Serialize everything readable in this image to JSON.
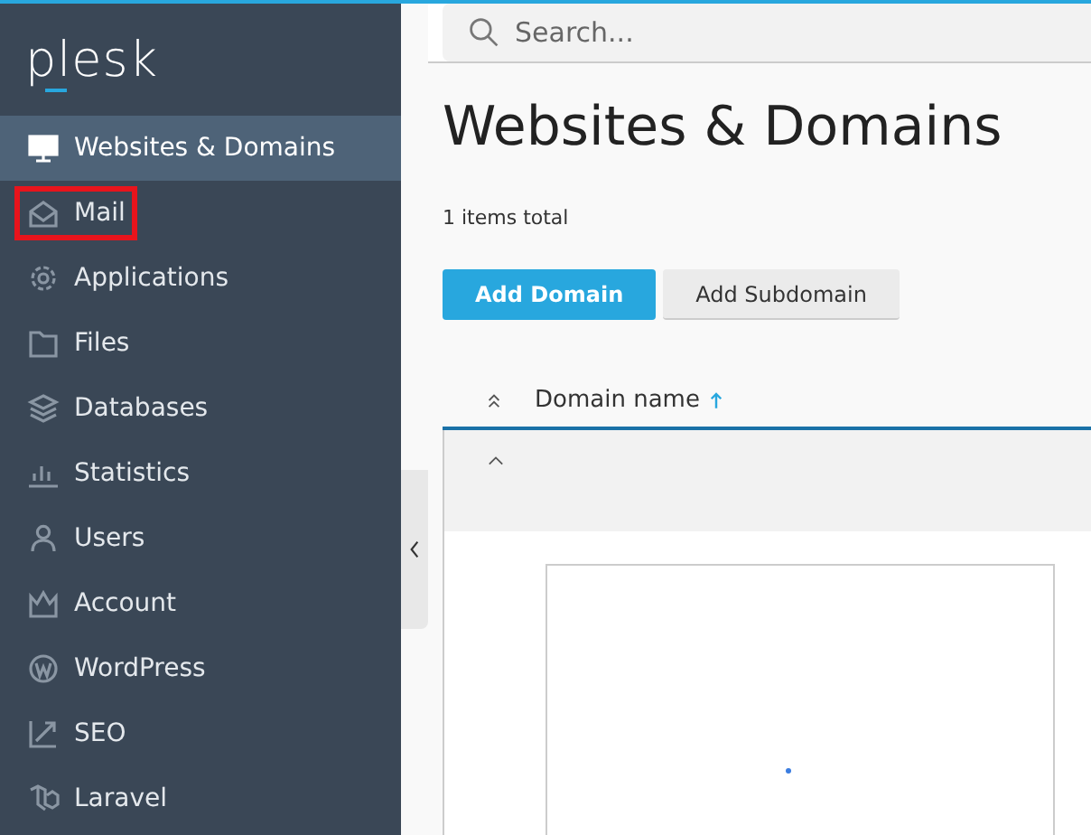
{
  "sidebar": {
    "logo": "plesk",
    "items": [
      {
        "label": "Websites & Domains",
        "selected": true,
        "highlighted": false
      },
      {
        "label": "Mail",
        "selected": false,
        "highlighted": true
      },
      {
        "label": "Applications",
        "selected": false,
        "highlighted": false
      },
      {
        "label": "Files",
        "selected": false,
        "highlighted": false
      },
      {
        "label": "Databases",
        "selected": false,
        "highlighted": false
      },
      {
        "label": "Statistics",
        "selected": false,
        "highlighted": false
      },
      {
        "label": "Users",
        "selected": false,
        "highlighted": false
      },
      {
        "label": "Account",
        "selected": false,
        "highlighted": false
      },
      {
        "label": "WordPress",
        "selected": false,
        "highlighted": false
      },
      {
        "label": "SEO",
        "selected": false,
        "highlighted": false
      },
      {
        "label": "Laravel",
        "selected": false,
        "highlighted": false
      }
    ]
  },
  "search": {
    "placeholder": "Search..."
  },
  "page": {
    "title": "Websites & Domains",
    "count": "1 items total",
    "buttons": [
      {
        "label": "Add Domain",
        "kind": "primary"
      },
      {
        "label": "Add Subdomain",
        "kind": "secondary"
      }
    ],
    "table": {
      "columns": [
        {
          "label": "Domain name",
          "sorted": true
        }
      ]
    }
  }
}
